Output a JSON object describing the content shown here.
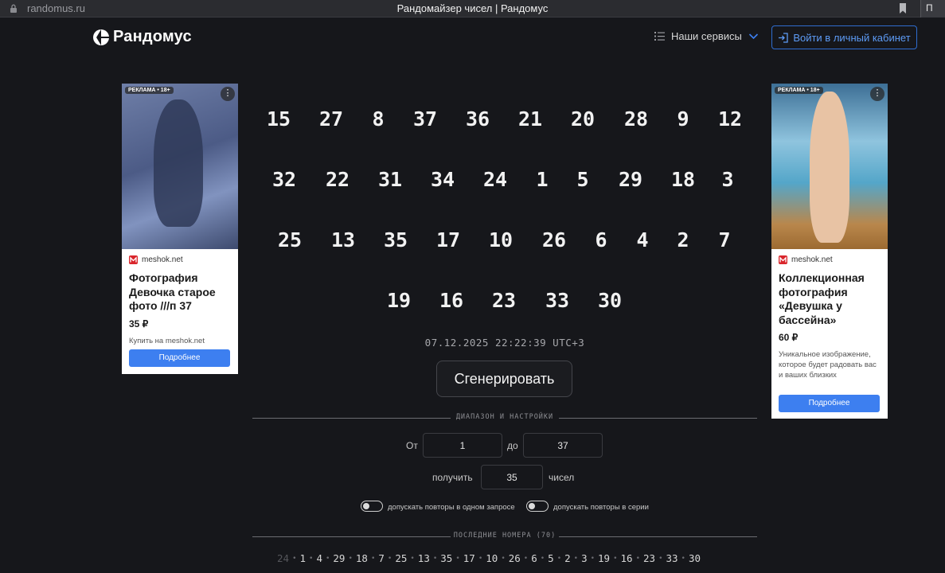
{
  "browser": {
    "url": "randomus.ru",
    "tab_title": "Рандомайзер чисел | Рандомус",
    "extension_label": "П"
  },
  "header": {
    "logo_text": "Рандомус",
    "services_label": "Наши сервисы",
    "login_label": "Войти в личный кабинет"
  },
  "ads": {
    "left": {
      "badge": "РЕКЛАМА • 18+",
      "source": "meshok.net",
      "title": "Фотография Девочка старое фото ///п 37",
      "price": "35 ₽",
      "desc": "Купить на meshok.net",
      "button": "Подробнее"
    },
    "right": {
      "badge": "РЕКЛАМА • 18+",
      "source": "meshok.net",
      "title": "Коллекционная фотография «Девушка у бассейна»",
      "price": "60 ₽",
      "desc": "Уникальное изображение, которое будет радовать вас и ваших близких",
      "button": "Подробнее"
    }
  },
  "result": {
    "numbers": [
      "15",
      "27",
      "8",
      "37",
      "36",
      "21",
      "20",
      "28",
      "9",
      "12",
      "32",
      "22",
      "31",
      "34",
      "24",
      "1",
      "5",
      "29",
      "18",
      "3",
      "25",
      "13",
      "35",
      "17",
      "10",
      "26",
      "6",
      "4",
      "2",
      "7",
      "19",
      "16",
      "23",
      "33",
      "30"
    ],
    "datetime": "07.12.2025 22:22:39 UTC+3",
    "generate_label": "Сгенерировать"
  },
  "settings": {
    "section_label": "ДИАПАЗОН И НАСТРОЙКИ",
    "from_label": "От",
    "from_value": "1",
    "to_label": "до",
    "to_value": "37",
    "get_label": "получить",
    "count_value": "35",
    "count_suffix": "чисел",
    "toggle_repeat_request": "допускать повторы в одном запросе",
    "toggle_repeat_series": "допускать повторы в серии"
  },
  "history": {
    "section_label": "ПОСЛЕДНИЕ НОМЕРА (70)",
    "items": [
      "24",
      "1",
      "4",
      "29",
      "18",
      "7",
      "25",
      "13",
      "35",
      "17",
      "10",
      "26",
      "6",
      "5",
      "2",
      "3",
      "19",
      "16",
      "23",
      "33",
      "30"
    ]
  }
}
